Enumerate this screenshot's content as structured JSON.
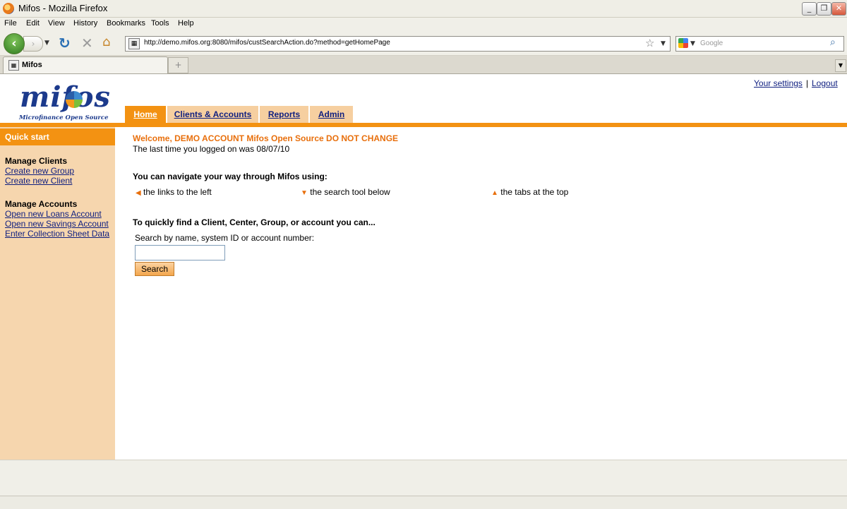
{
  "window": {
    "title": "Mifos - Mozilla Firefox"
  },
  "menu": [
    "File",
    "Edit",
    "View",
    "History",
    "Bookmarks",
    "Tools",
    "Help"
  ],
  "navbar": {
    "url": "http://demo.mifos.org:8080/mifos/custSearchAction.do?method=getHomePage",
    "search_placeholder": "Google"
  },
  "tab": {
    "title": "Mifos"
  },
  "logo": {
    "text": "mifos",
    "tagline": "Microfinance Open Source"
  },
  "top_links": {
    "settings": "Your settings",
    "separator": "|",
    "logout": "Logout"
  },
  "nav_tabs": [
    {
      "label": "Home",
      "active": true
    },
    {
      "label": "Clients & Accounts",
      "active": false
    },
    {
      "label": "Reports",
      "active": false
    },
    {
      "label": "Admin",
      "active": false
    }
  ],
  "sidebar": {
    "title": "Quick start",
    "sections": [
      {
        "heading": "Manage Clients",
        "links": [
          "Create new Group",
          "Create new Client"
        ]
      },
      {
        "heading": "Manage Accounts",
        "links": [
          "Open new Loans Account",
          "Open new Savings Account",
          "Enter Collection Sheet Data"
        ]
      }
    ]
  },
  "main": {
    "welcome": "Welcome,  DEMO ACCOUNT Mifos Open Source DO NOT CHANGE",
    "last_login": "The last time you logged on was 08/07/10",
    "navigate_heading": "You can navigate your way through Mifos using:",
    "hints": [
      "the links to the left",
      "the search tool below",
      "the tabs at the top"
    ],
    "quick_heading": "To quickly find a Client, Center,  Group, or account you can...",
    "search_label": "Search by name, system ID or account number:",
    "search_value": "",
    "search_button": "Search"
  },
  "colors": {
    "accent": "#f39212",
    "sidebar": "#f6d6ae",
    "link": "#0f1f80",
    "welcome": "#e86f0c"
  }
}
